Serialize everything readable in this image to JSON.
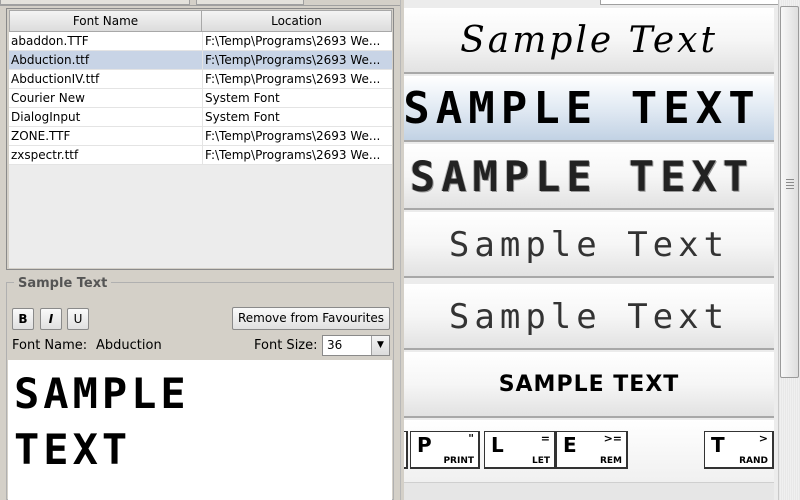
{
  "font_table": {
    "columns": [
      "Font Name",
      "Location"
    ],
    "rows": [
      {
        "name": "abaddon.TTF",
        "location": "F:\\Temp\\Programs\\2693 We..."
      },
      {
        "name": "Abduction.ttf",
        "location": "F:\\Temp\\Programs\\2693 We...",
        "selected": true
      },
      {
        "name": "AbductionIV.ttf",
        "location": "F:\\Temp\\Programs\\2693 We..."
      },
      {
        "name": "Courier New",
        "location": "System Font"
      },
      {
        "name": "DialogInput",
        "location": "System Font"
      },
      {
        "name": "ZONE.TTF",
        "location": "F:\\Temp\\Programs\\2693 We..."
      },
      {
        "name": "zxspectr.ttf",
        "location": "F:\\Temp\\Programs\\2693 We..."
      }
    ]
  },
  "sample_panel": {
    "legend": "Sample Text",
    "bold_label": "B",
    "italic_label": "I",
    "underline_label": "U",
    "favourites_button": "Remove from Favourites",
    "font_name_label": "Font Name:",
    "font_name_value": "Abduction",
    "font_size_label": "Font Size:",
    "font_size_value": "36",
    "preview_text": "SAMPLE TEXT"
  },
  "samples": [
    {
      "text": "Sample Text"
    },
    {
      "text": "SAMPLE TEXT",
      "selected": true
    },
    {
      "text": "SAMPLE TEXT"
    },
    {
      "text": "Sample Text"
    },
    {
      "text": "Sample Text"
    },
    {
      "text": "SAMPLE TEXT"
    }
  ],
  "keys": [
    {
      "letter": "P",
      "symbol": "\"",
      "word": "PRINT"
    },
    {
      "letter": "L",
      "symbol": "=",
      "word": "LET"
    },
    {
      "letter": "E",
      "symbol": ">=",
      "word": "REM"
    },
    {
      "letter": "T",
      "symbol": ">",
      "word": "RAND"
    }
  ],
  "icons": {
    "dropdown": "chevron-down-icon"
  },
  "colors": {
    "selection": "#c8d4e6",
    "panel": "#d4d0c8"
  }
}
